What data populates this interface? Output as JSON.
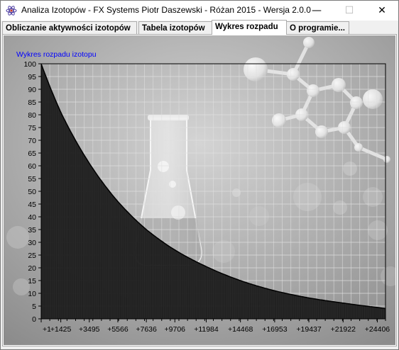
{
  "window": {
    "title": "Analiza Izotopów - FX Systems Piotr Daszewski - Różan 2015 - Wersja 2.0.0",
    "minimize_glyph": "—",
    "maximize_glyph": "☐",
    "close_glyph": "✕"
  },
  "tabs": [
    {
      "label": "Obliczanie aktywności izotopów",
      "active": false
    },
    {
      "label": "Tabela izotopów",
      "active": false
    },
    {
      "label": "Wykres rozpadu",
      "active": true
    },
    {
      "label": "O programie...",
      "active": false
    }
  ],
  "chart_data": {
    "type": "area",
    "title": "Wykres rozpadu izotopu",
    "xlabel": "",
    "ylabel": "",
    "ylim": [
      0,
      100
    ],
    "y_ticks": [
      0,
      5,
      10,
      15,
      20,
      25,
      30,
      35,
      40,
      45,
      50,
      55,
      60,
      65,
      70,
      75,
      80,
      85,
      90,
      95,
      100
    ],
    "x_ticks": [
      "+1",
      "+1425",
      "+3495",
      "+5566",
      "+7636",
      "+9706",
      "+11984",
      "+14468",
      "+16953",
      "+19437",
      "+21922",
      "+24406"
    ],
    "xlim": [
      1,
      25000
    ],
    "grid": true,
    "series": [
      {
        "x": [
          1,
          1425,
          3495,
          5566,
          7636,
          9706,
          11984,
          14468,
          16953,
          19437,
          21922,
          24406,
          25000
        ],
        "values": [
          100,
          81,
          61,
          46,
          35,
          27,
          20.5,
          15,
          11,
          8.2,
          6.2,
          4.5,
          4
        ]
      }
    ],
    "colors": {
      "title": "#0000ff",
      "area": "#1a1a1a",
      "background": "#a8a8a8"
    }
  }
}
